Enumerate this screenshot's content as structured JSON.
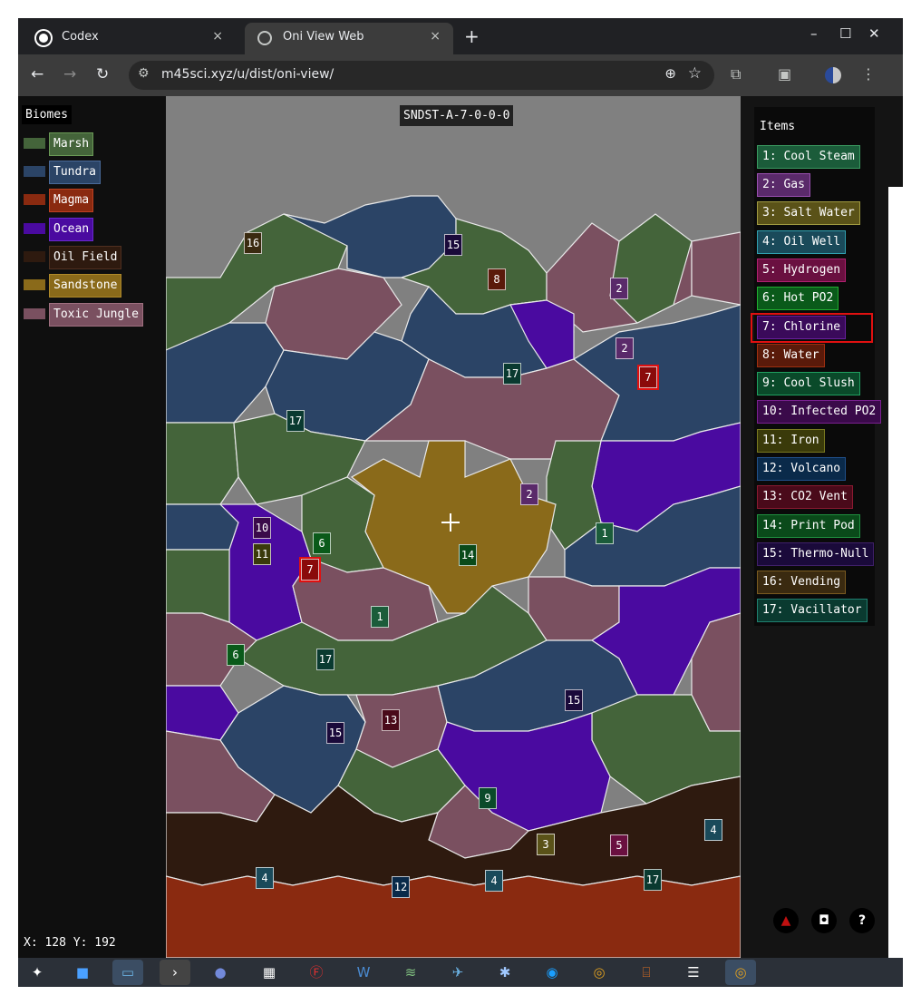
{
  "browser": {
    "tabs": [
      {
        "title": "Codex",
        "close": "×"
      },
      {
        "title": "Oni View Web",
        "close": "×"
      }
    ],
    "new_tab": "+",
    "window_controls": {
      "minimize": "–",
      "maximize": "☐",
      "close": "✕"
    },
    "nav": {
      "back": "←",
      "forward": "→",
      "reload": "↻"
    },
    "url": "m45sci.xyz/u/dist/oni-view/",
    "zoom_icon": "⊕",
    "star_icon": "☆"
  },
  "page": {
    "seed": "SNDST-A-7-0-0-0",
    "biomes_title": "Biomes",
    "biomes": [
      {
        "label": "Marsh",
        "color": "#44643a",
        "border": "#6a9a56"
      },
      {
        "label": "Tundra",
        "color": "#2b4466",
        "border": "#4a6a9a"
      },
      {
        "label": "Magma",
        "color": "#8a2a10",
        "border": "#c04020"
      },
      {
        "label": "Ocean",
        "color": "#4a0aa0",
        "border": "#6a2ad0"
      },
      {
        "label": "Oil Field",
        "color": "#2e1a0f",
        "border": "#503020"
      },
      {
        "label": "Sandstone",
        "color": "#8a6a1a",
        "border": "#b08a2a"
      },
      {
        "label": "Toxic Jungle",
        "color": "#7a5060",
        "border": "#a07080"
      }
    ],
    "coords": "X: 128 Y: 192",
    "items_title": "Items",
    "items": [
      {
        "label": "1: Cool Steam",
        "color": "#1b5c3a",
        "border": "#3a9a60"
      },
      {
        "label": "2: Gas",
        "color": "#5a2a6a",
        "border": "#9a50b0"
      },
      {
        "label": "3: Salt Water",
        "color": "#5a5218",
        "border": "#a09a40"
      },
      {
        "label": "4: Oil Well",
        "color": "#1a4a5a",
        "border": "#30a0b0"
      },
      {
        "label": "5: Hydrogen",
        "color": "#6a1040",
        "border": "#b02070"
      },
      {
        "label": "6: Hot PO2",
        "color": "#0a5a1a",
        "border": "#20b030"
      },
      {
        "label": "7: Chlorine",
        "color": "#3a0a5a",
        "border": "#6a20a0"
      },
      {
        "label": "8: Water",
        "color": "#5a1a0a",
        "border": "#a03010"
      },
      {
        "label": "9: Cool Slush",
        "color": "#0a4a2a",
        "border": "#20a060"
      },
      {
        "label": "10: Infected PO2",
        "color": "#3a0a4a",
        "border": "#7a2090"
      },
      {
        "label": "11: Iron",
        "color": "#3a3a0a",
        "border": "#7a7a20"
      },
      {
        "label": "12: Volcano",
        "color": "#0a2a4a",
        "border": "#20508a"
      },
      {
        "label": "13: CO2 Vent",
        "color": "#4a0a1a",
        "border": "#8a1a30"
      },
      {
        "label": "14: Print Pod",
        "color": "#0a4a1a",
        "border": "#209040"
      },
      {
        "label": "15: Thermo-Null",
        "color": "#1a0a3a",
        "border": "#40206a"
      },
      {
        "label": "16: Vending",
        "color": "#3a2a10",
        "border": "#7a5a20"
      },
      {
        "label": "17: Vacillator",
        "color": "#0a3a30",
        "border": "#208070"
      }
    ],
    "map_markers": [
      {
        "n": "16",
        "item": 16
      },
      {
        "n": "15",
        "item": 15
      },
      {
        "n": "8",
        "item": 8
      },
      {
        "n": "2",
        "item": 2
      },
      {
        "n": "2",
        "item": 2
      },
      {
        "n": "7",
        "item": 7
      },
      {
        "n": "17",
        "item": 17
      },
      {
        "n": "17",
        "item": 17
      },
      {
        "n": "2",
        "item": 2
      },
      {
        "n": "1",
        "item": 1
      },
      {
        "n": "10",
        "item": 10
      },
      {
        "n": "11",
        "item": 11
      },
      {
        "n": "6",
        "item": 6
      },
      {
        "n": "7",
        "item": 7
      },
      {
        "n": "14",
        "item": 14
      },
      {
        "n": "1",
        "item": 1
      },
      {
        "n": "6",
        "item": 6
      },
      {
        "n": "17",
        "item": 17
      },
      {
        "n": "15",
        "item": 15
      },
      {
        "n": "13",
        "item": 13
      },
      {
        "n": "15",
        "item": 15
      },
      {
        "n": "9",
        "item": 9
      },
      {
        "n": "3",
        "item": 3
      },
      {
        "n": "5",
        "item": 5
      },
      {
        "n": "4",
        "item": 4
      },
      {
        "n": "4",
        "item": 4
      },
      {
        "n": "12",
        "item": 12
      },
      {
        "n": "4",
        "item": 4
      },
      {
        "n": "17",
        "item": 17
      }
    ],
    "bottom_buttons": {
      "help": "?"
    }
  }
}
